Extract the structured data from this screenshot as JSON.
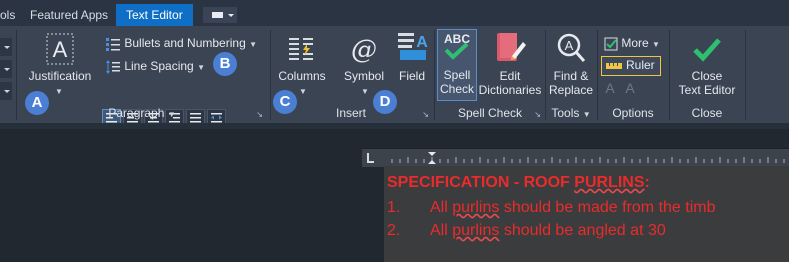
{
  "tabs": [
    {
      "label": "ols"
    },
    {
      "label": "Featured Apps"
    },
    {
      "label": "Text Editor",
      "active": true
    }
  ],
  "paragraph": {
    "justification_label": "Justification",
    "bullets_label": "Bullets and Numbering",
    "line_spacing_label": "Line Spacing",
    "panel_label": "Paragraph"
  },
  "insert": {
    "columns_label": "Columns",
    "symbol_label": "Symbol",
    "field_label": "Field",
    "panel_label": "Insert"
  },
  "spellcheck": {
    "spell_label_1": "Spell",
    "spell_label_2": "Check",
    "edit_label_1": "Edit",
    "edit_label_2": "Dictionaries",
    "panel_label": "Spell Check"
  },
  "tools": {
    "find_label_1": "Find &",
    "find_label_2": "Replace",
    "panel_label": "Tools"
  },
  "options": {
    "more_label": "More",
    "ruler_label": "Ruler",
    "panel_label": "Options"
  },
  "close": {
    "label_1": "Close",
    "label_2": "Text Editor",
    "panel_label": "Close"
  },
  "badges": {
    "a1": "A",
    "b": "B",
    "c": "C",
    "d": "D"
  },
  "editor": {
    "heading_prefix": "SPECIFICATION - ROOF ",
    "heading_squiggle": "PURLINS",
    "heading_suffix": ":",
    "line1_num": "1.",
    "line1_pre": "All ",
    "line1_squiggle": "purlins",
    "line1_post": " should be made from the timb",
    "line2_num": "2.",
    "line2_pre": "All ",
    "line2_squiggle": "purlins",
    "line2_post": " should be angled at 30"
  },
  "colors": {
    "accent": "#0f6fc6",
    "ribbon": "#3b4453",
    "badge": "#4a7fd4",
    "editor_text": "#ea2b2b",
    "check_green": "#2fbf71"
  }
}
